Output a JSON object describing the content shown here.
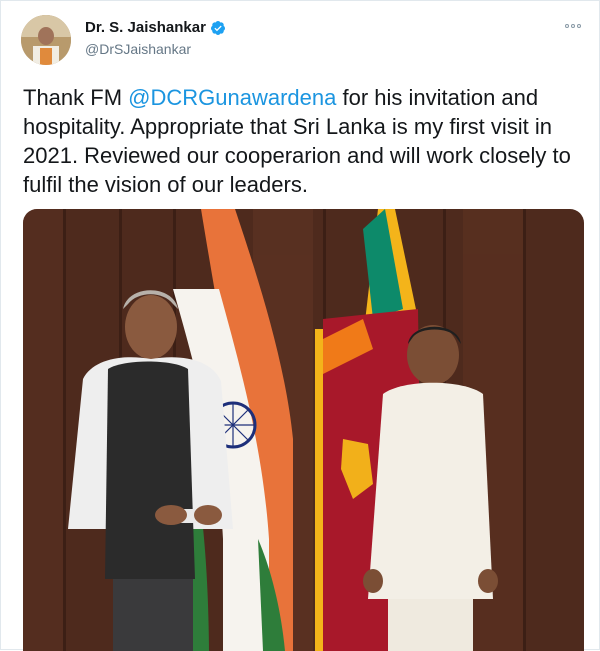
{
  "author": {
    "display_name": "Dr. S. Jaishankar",
    "handle": "@DrSJaishankar",
    "verified_icon": "verified-badge-icon"
  },
  "tweet": {
    "text_before_mention": "Thank FM ",
    "mention": "@DCRGunawardena",
    "text_after_mention": " for his invitation and hospitality. Appropriate that Sri Lanka is my first visit in 2021. Reviewed our cooperarion and will work closely to fulfil the vision of our leaders."
  },
  "menu": {
    "icon": "more-options-icon"
  },
  "colors": {
    "mention": "#1b95e0",
    "handle": "#657786",
    "verified": "#1da1f2"
  }
}
